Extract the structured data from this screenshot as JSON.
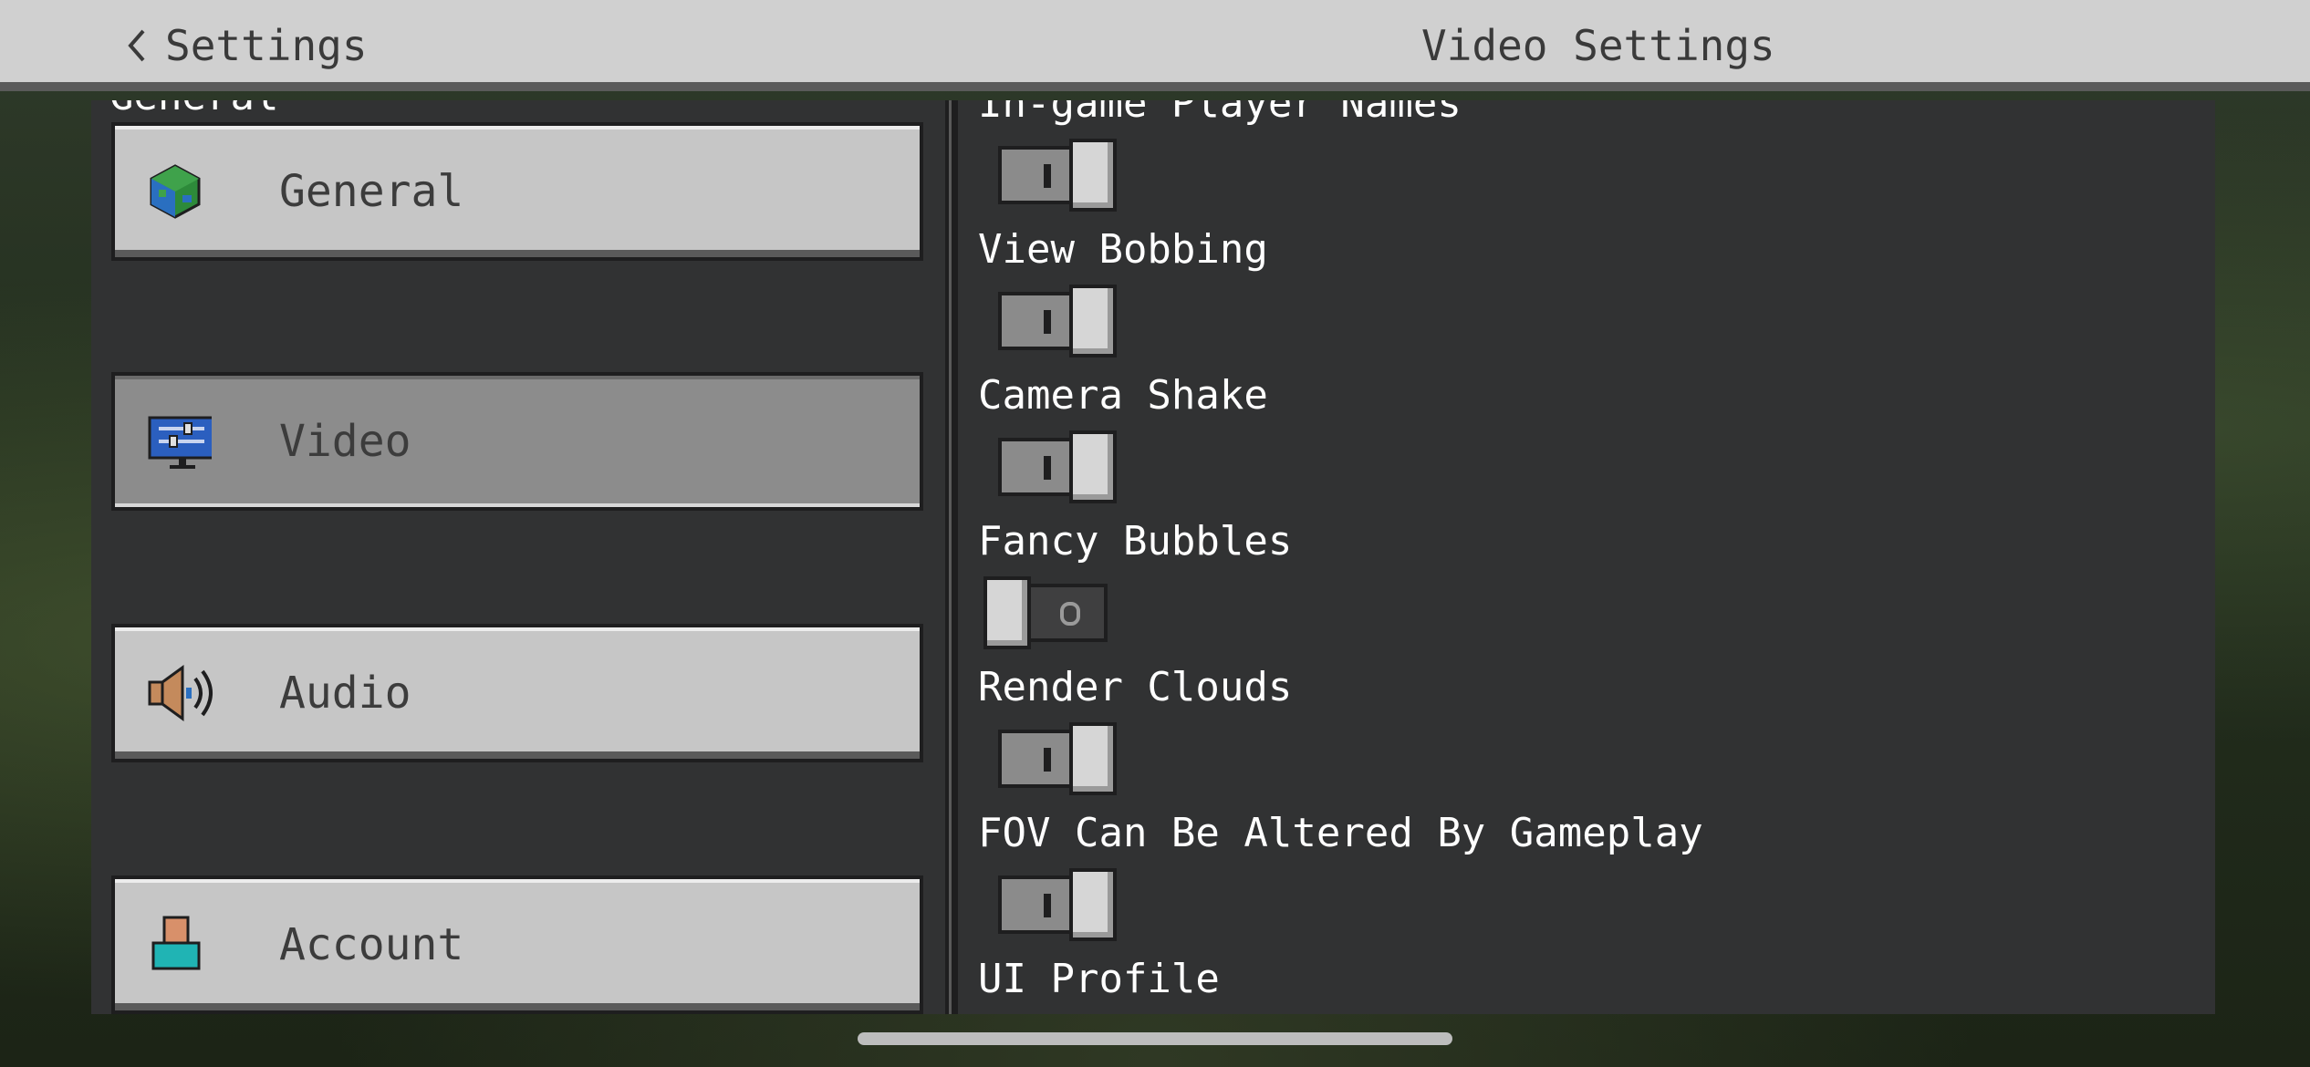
{
  "header": {
    "back_label": "Settings",
    "title": "Video Settings"
  },
  "sidebar": {
    "section_header_partial": "General",
    "items": [
      {
        "label": "General",
        "icon": "globe-icon",
        "selected": false
      },
      {
        "label": "Video",
        "icon": "monitor-icon",
        "selected": true
      },
      {
        "label": "Audio",
        "icon": "speaker-icon",
        "selected": false
      },
      {
        "label": "Account",
        "icon": "person-icon",
        "selected": false
      }
    ]
  },
  "settings": {
    "partial_top_label": "In-game Player Names",
    "items": [
      {
        "label": "In-game Player Names",
        "state": "on"
      },
      {
        "label": "View Bobbing",
        "state": "on"
      },
      {
        "label": "Camera Shake",
        "state": "on"
      },
      {
        "label": "Fancy Bubbles",
        "state": "off"
      },
      {
        "label": "Render Clouds",
        "state": "on"
      },
      {
        "label": "FOV Can Be Altered By Gameplay",
        "state": "on"
      }
    ],
    "partial_bottom_label": "UI Profile"
  },
  "colors": {
    "header_bg": "#d0d0d0",
    "panel_bg": "#313233",
    "button_bg": "#c6c6c6",
    "button_selected_bg": "#8c8c8c",
    "text_light": "#ffffff",
    "text_dark": "#3c3c3c"
  }
}
